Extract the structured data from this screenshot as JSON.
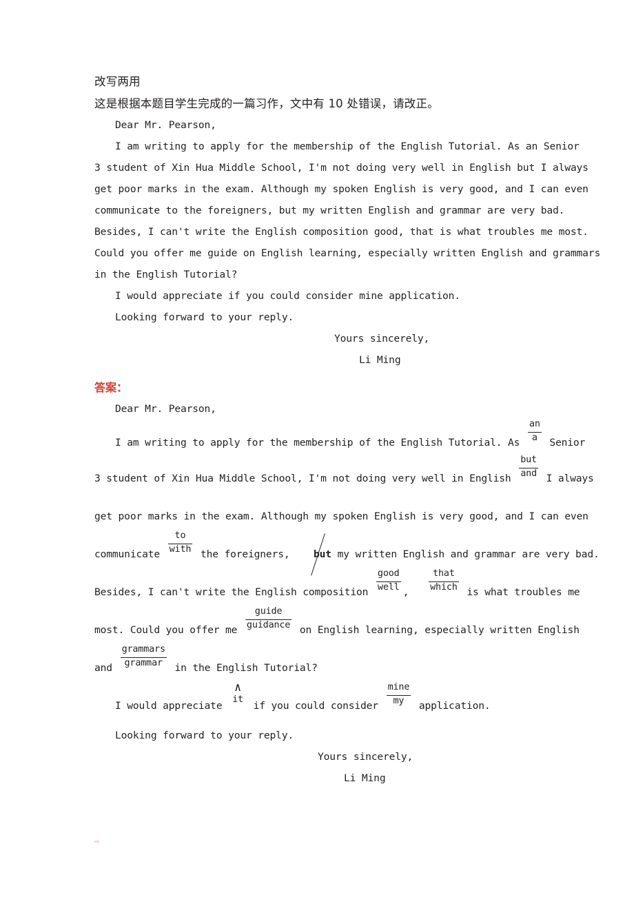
{
  "document": {
    "title": "改写两用",
    "instruction": "这是根据本题目学生完成的一篇习作，文中有 10 处错误，请改正。",
    "answer_label": "答案："
  },
  "original_letter": {
    "salutation": "Dear Mr. Pearson,",
    "body_lines": [
      "I am writing to apply for the membership of the English Tutorial. As an Senior",
      "3 student of Xin Hua Middle School, I'm not doing very well in English but I always",
      "get poor marks in the exam. Although my spoken English is very good, and I can even",
      "communicate to the foreigners, but my written English and grammar are very bad.",
      "Besides, I can't write the English composition good, that is what troubles me most.",
      "Could you offer me guide on English learning, especially written English and grammars",
      "in the English Tutorial?"
    ],
    "closing_lines": [
      "I would appreciate if you could consider mine application.",
      "Looking forward to your reply."
    ],
    "sign_off": "Yours sincerely,",
    "signature": "Li Ming"
  },
  "answer_letter": {
    "salutation": "Dear Mr. Pearson,",
    "line1_a": "I am writing to apply for the membership of the English Tutorial. As",
    "corr1": {
      "wrong": "an",
      "right": "a"
    },
    "line1_b": "Senior",
    "line2_a": "3 student of Xin Hua Middle School, I'm not doing very well in English",
    "corr2": {
      "wrong": "but",
      "right": "and"
    },
    "line2_b": "I always",
    "line3": "get poor marks in the exam. Although my spoken English is very good, and I can even",
    "line4_a": "communicate",
    "corr3": {
      "wrong": "to",
      "right": "with"
    },
    "line4_b": "the foreigners,",
    "delete1": "but",
    "line4_c": "my written English and grammar are very bad.",
    "line5_a": "Besides, I can't write the English composition",
    "corr4": {
      "wrong": "good",
      "right": "well"
    },
    "line5_comma": ",",
    "corr5": {
      "wrong": "that",
      "right": "which"
    },
    "line5_b": "is what troubles me",
    "line6_a": "most. Could you offer me",
    "corr6": {
      "wrong": "guide",
      "right": "guidance"
    },
    "line6_b": "on English learning, especially written English",
    "line7_a": "and",
    "corr7": {
      "wrong": "grammars",
      "right": "grammar"
    },
    "line7_b": "in the English Tutorial?",
    "line8_a": "I would appreciate",
    "insert1": {
      "caret": "∧",
      "word": "it"
    },
    "line8_b": "if you could consider",
    "corr8": {
      "wrong": "mine",
      "right": "my"
    },
    "line8_c": "application.",
    "line9": "Looking forward to your reply.",
    "sign_off": "Yours sincerely,",
    "signature": "Li Ming"
  },
  "colors": {
    "text": "#231f20",
    "answer_red": "#e03a2f"
  }
}
